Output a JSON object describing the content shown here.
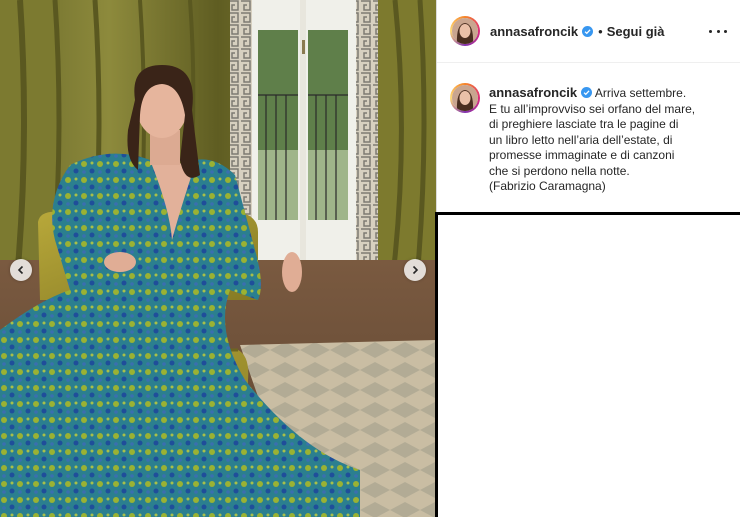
{
  "post": {
    "username": "annasafroncik",
    "verified": true,
    "separator": "•",
    "follow_label": "Segui già",
    "more_icon": "more-horizontal-icon"
  },
  "caption": {
    "username": "annasafroncik",
    "first_line": "Arriva settembre.",
    "lines": [
      "E tu all’improvviso sei orfano del mare,",
      "di preghiere lasciate tra le pagine di",
      "un libro letto nell’aria dell’estate, di",
      "promesse immaginate e di canzoni",
      "che si perdono nella notte.",
      "(Fabrizio Caramagna)"
    ]
  },
  "carousel": {
    "prev_icon": "chevron-left-icon",
    "next_icon": "chevron-right-icon"
  },
  "colors": {
    "text": "#262626",
    "verified": "#3897f0",
    "divider": "#efefef"
  }
}
